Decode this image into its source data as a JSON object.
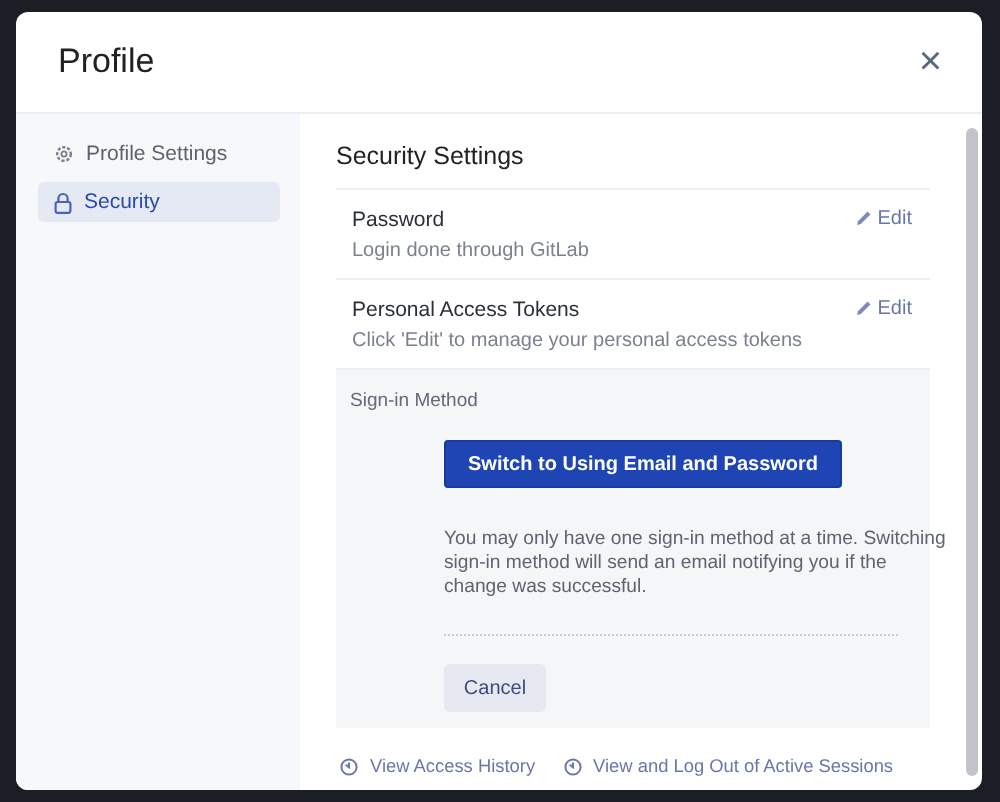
{
  "dialog": {
    "title": "Profile",
    "close": "×"
  },
  "sidebar": {
    "items": [
      {
        "label": "Profile Settings",
        "kind": "settings",
        "selected": false
      },
      {
        "label": "Security",
        "kind": "security",
        "selected": true
      }
    ]
  },
  "content": {
    "heading": "Security Settings",
    "rows": [
      {
        "title": "Password",
        "description": "Login done through GitLab",
        "action": "Edit"
      },
      {
        "title": "Personal Access Tokens",
        "description": "Click 'Edit' to manage your personal access tokens",
        "action": "Edit"
      }
    ],
    "sign_in": {
      "label": "Sign-in Method",
      "primary_button": "Switch to Using Email and Password",
      "note": "You may only have one sign-in method at a time. Switching sign-in method will send an email notifying you if the change was successful.",
      "cancel_button": "Cancel"
    },
    "links": [
      "View Access History",
      "View and Log Out of Active Sessions"
    ]
  }
}
